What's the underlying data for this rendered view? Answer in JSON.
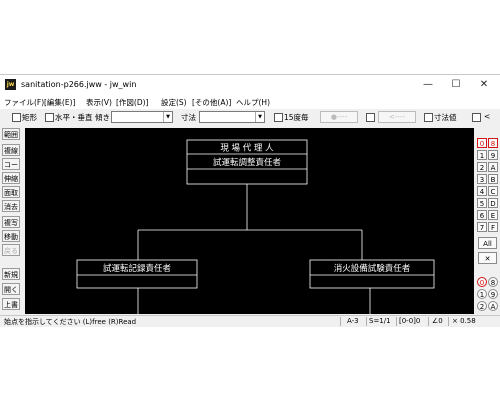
{
  "window": {
    "title": "sanitation-p266.jww - jw_win",
    "app_icon": "jw",
    "controls": {
      "minimize": "—",
      "maximize": "☐",
      "close": "✕"
    }
  },
  "menu": [
    "ファイル(F)",
    "[編集(E)]",
    "表示(V)",
    "[作図(D)]",
    "設定(S)",
    "[その他(A)]",
    "ヘルプ(H)"
  ],
  "toolbar": {
    "rect_label": "矩形",
    "hv_label": "水平・垂直",
    "slope_label": "傾き",
    "size_label": "寸法",
    "deg15_label": "15度毎",
    "arrow_left": "<----",
    "dim_value_label": "寸法値",
    "lt_label": "<",
    "dot_label": "●----"
  },
  "left_buttons": [
    "範囲",
    "複線",
    "コーナー",
    "伸縮",
    "面取",
    "消去",
    "複写",
    "移動",
    "戻る",
    "新規",
    "開く",
    "上書"
  ],
  "right_buttons": {
    "col1": [
      "0",
      "1",
      "2",
      "3",
      "4",
      "5",
      "6",
      "7"
    ],
    "col2": [
      "8",
      "9",
      "A",
      "B",
      "C",
      "D",
      "E",
      "F"
    ],
    "all": "All",
    "cross": "✕",
    "circ_col1": [
      "0",
      "1",
      "2"
    ],
    "circ_col2": [
      "8",
      "9",
      "A"
    ]
  },
  "drawing": {
    "top_box": {
      "title": "現 場 代 理 人",
      "sub": "試運転調整責任者"
    },
    "left_box": {
      "title": "試運転記録責任者"
    },
    "right_box": {
      "title": "消火設備試験責任者"
    }
  },
  "status": {
    "message": "始点を指示してください (L)free (R)Read",
    "layer": "A-3",
    "scale": "S=1/1",
    "group": "[0-0]0",
    "angle": "∠0",
    "zoom": "× 0.58"
  }
}
